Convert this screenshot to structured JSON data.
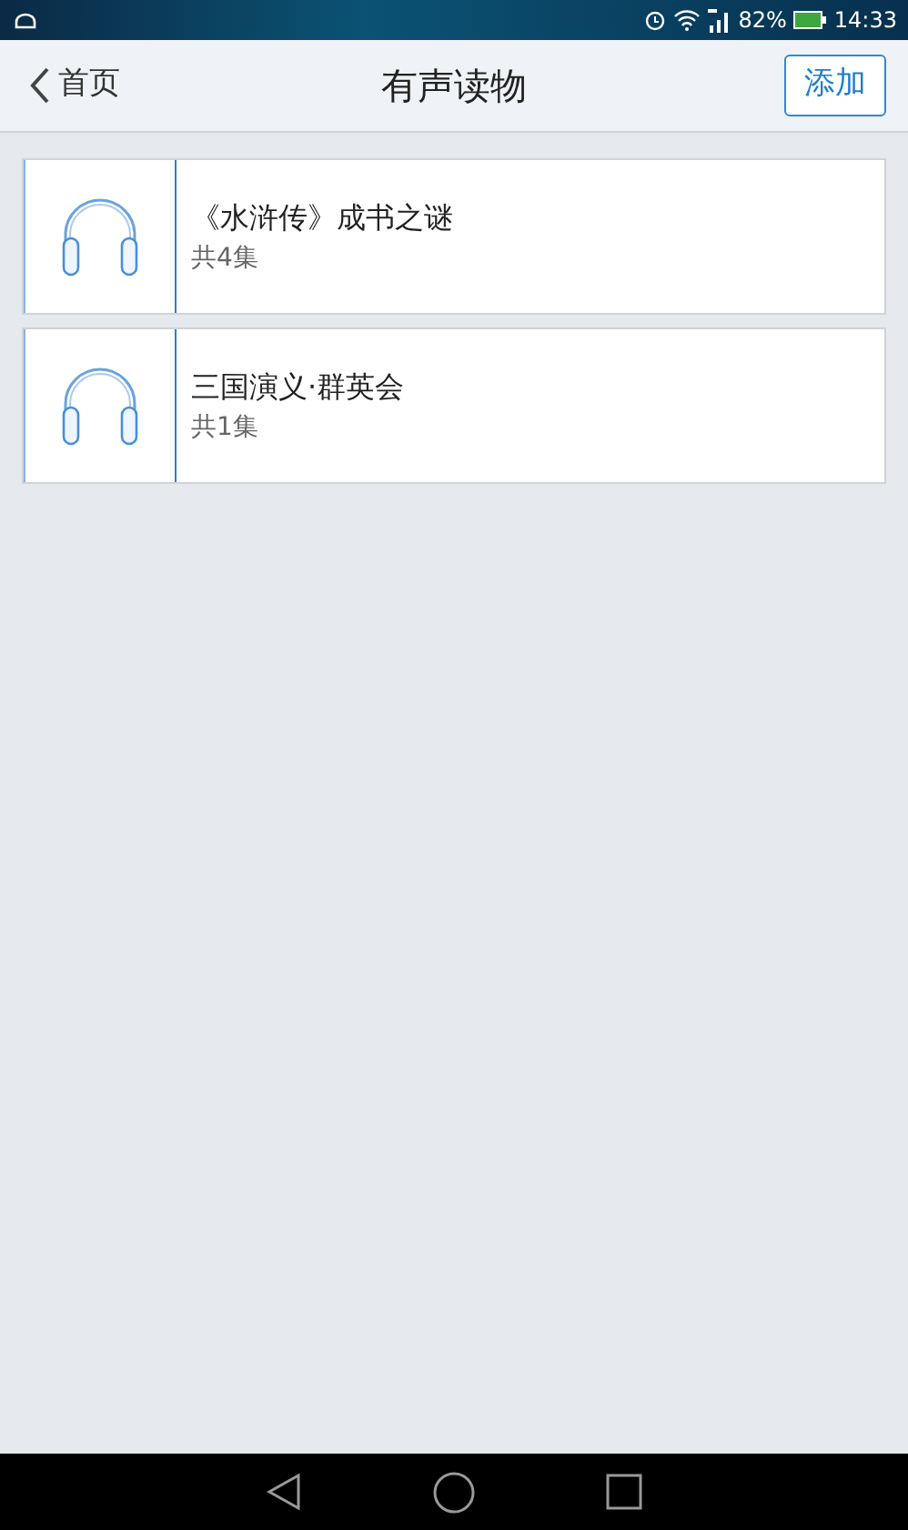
{
  "status_bar": {
    "battery": "82%",
    "time": "14:33"
  },
  "header": {
    "back_label": "首页",
    "title": "有声读物",
    "action": "添加"
  },
  "items": [
    {
      "title": "《水浒传》成书之谜",
      "episodes": "共4集"
    },
    {
      "title": "三国演义·群英会",
      "episodes": "共1集"
    }
  ]
}
